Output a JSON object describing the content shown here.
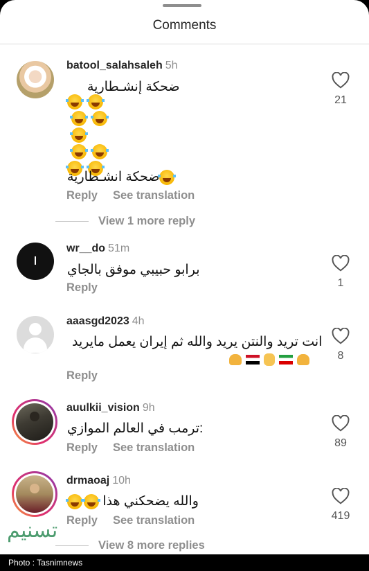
{
  "sheet": {
    "title": "Comments"
  },
  "comments": [
    {
      "username": "batool_salahsaleh",
      "time": "5h",
      "text_line1": "ضحكة إنشـطارية",
      "text_line2": "ضحكة انشـطارية",
      "likes": "21",
      "reply_label": "Reply",
      "translation_label": "See translation",
      "more_replies": "View 1 more reply"
    },
    {
      "username": "wr__do",
      "time": "51m",
      "text": "برابو حبيبي موفق بالجاي",
      "likes": "1",
      "reply_label": "Reply"
    },
    {
      "username": "aaasgd2023",
      "time": "4h",
      "text": "انت تريد والنتن يريد والله ثم إيران يعمل مايريد",
      "likes": "8",
      "reply_label": "Reply"
    },
    {
      "username": "auulkii_vision",
      "time": "9h",
      "text": "ترمب في العالم الموازي:",
      "likes": "89",
      "reply_label": "Reply",
      "translation_label": "See translation"
    },
    {
      "username": "drmaoaj",
      "time": "10h",
      "text": "والله يضحكني هذا",
      "likes": "419",
      "reply_label": "Reply",
      "translation_label": "See translation",
      "more_replies": "View 8 more replies"
    }
  ],
  "icons": {
    "like": "heart-outline-icon",
    "laugh": "rolling-laughing-emoji",
    "flag_egypt": "egypt-flag-emoji",
    "flag_iran": "iran-flag-emoji",
    "muscle": "flexed-biceps-emoji",
    "peace": "victory-hand-emoji"
  },
  "colors": {
    "accent_ring": "#e1306c",
    "muted_text": "#8e8e8e"
  },
  "footer": {
    "credit": "Photo : Tasnimnews"
  },
  "watermark": {
    "text": "تسنيم"
  }
}
